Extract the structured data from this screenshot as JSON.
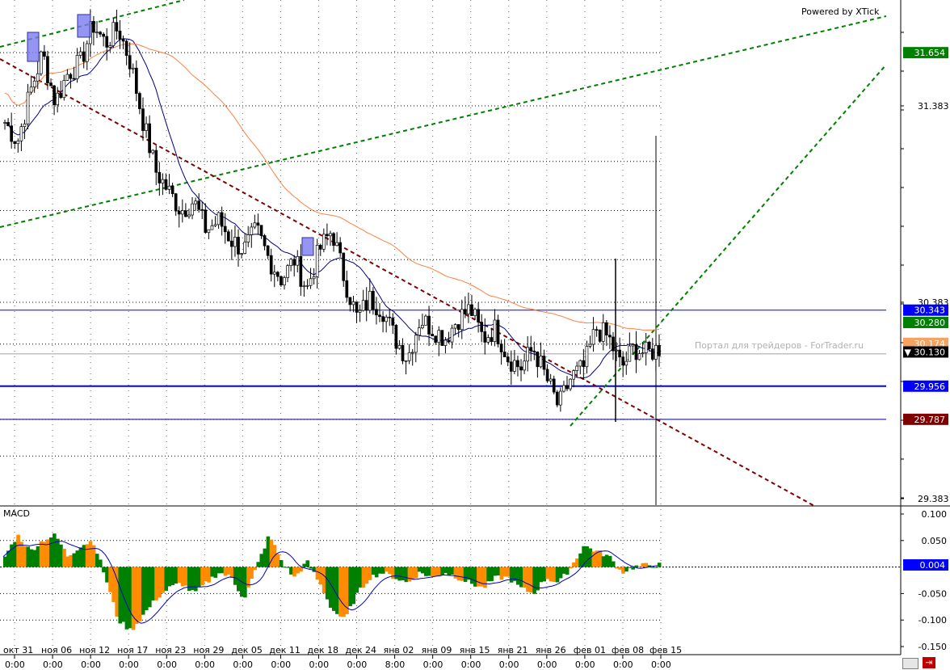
{
  "powered_by": "Powered by XTick",
  "watermark": "Портал для трейдеров - ForTrader.ru",
  "price_axis": {
    "ticks": [
      "31.383",
      "30.383",
      "29.383"
    ],
    "tick_values": [
      31.383,
      30.383,
      29.383
    ]
  },
  "price_labels": [
    {
      "text": "31.654",
      "value": 31.654,
      "bg": "#008000",
      "fg": "#ffffff"
    },
    {
      "text": "30.343",
      "value": 30.343,
      "bg": "#0000ff",
      "fg": "#ffffff"
    },
    {
      "text": "30.280",
      "value": 30.28,
      "bg": "#008000",
      "fg": "#ffffff"
    },
    {
      "text": "30.174",
      "value": 30.174,
      "bg": "#f4a460",
      "fg": "#ffffff"
    },
    {
      "text": "▼ 30.130",
      "value": 30.13,
      "bg": "#000000",
      "fg": "#ffffff"
    },
    {
      "text": "29.956",
      "value": 29.956,
      "bg": "#0000ff",
      "fg": "#ffffff"
    },
    {
      "text": "29.787",
      "value": 29.787,
      "bg": "#800000",
      "fg": "#ffffff"
    }
  ],
  "macd_panel": {
    "label": "MACD",
    "ticks": [
      "0.100",
      "0.050",
      "-0.050",
      "-0.100",
      "-0.150"
    ],
    "tick_values": [
      0.1,
      0.05,
      -0.05,
      -0.1,
      -0.15
    ],
    "current_label": {
      "text": "0.004",
      "value": 0.004,
      "bg": "#0000ff",
      "fg": "#ffffff"
    }
  },
  "time_axis": {
    "dates": [
      "окт 31",
      "ноя 06",
      "ноя 12",
      "ноя 17",
      "ноя 23",
      "ноя 29",
      "дек 05",
      "дек 11",
      "дек 18",
      "дек 24",
      "янв 02",
      "янв 09",
      "янв 15",
      "янв 21",
      "янв 26",
      "фев 01",
      "фев 08",
      "фев 15"
    ],
    "times": [
      "0:00",
      "0:00",
      "0:00",
      "0:00",
      "0:00",
      "0:00",
      "0:00",
      "0:00",
      "0:00",
      "0:00",
      "8:00",
      "0:00",
      "0:00",
      "0:00",
      "0:00",
      "0:00",
      "0:00",
      "0:00"
    ]
  },
  "colors": {
    "up_candle": "#000000",
    "down_candle": "#000000",
    "ma_fast": "#000080",
    "ma_slow": "#ff7f3f",
    "trend_green": "#008000",
    "trend_red": "#800000",
    "hist_up": "#008000",
    "hist_down": "#ff8c00",
    "level_blue": "#0000ff"
  },
  "chart_data": {
    "type": "candlestick",
    "instrument": "",
    "ylim": [
      29.383,
      31.9
    ],
    "x_categories": [
      "окт 31",
      "ноя 06",
      "ноя 12",
      "ноя 17",
      "ноя 23",
      "ноя 29",
      "дек 05",
      "дек 11",
      "дек 18",
      "дек 24",
      "янв 02",
      "янв 09",
      "янв 15",
      "янв 21",
      "янв 26",
      "фев 01",
      "фев 08",
      "фев 15"
    ],
    "close_path": [
      31.3,
      31.2,
      31.45,
      31.65,
      31.4,
      31.55,
      31.6,
      31.8,
      31.7,
      31.78,
      31.6,
      31.3,
      31.05,
      30.95,
      30.85,
      30.9,
      30.75,
      30.8,
      30.7,
      30.65,
      30.75,
      30.6,
      30.5,
      30.6,
      30.45,
      30.65,
      30.75,
      30.5,
      30.3,
      30.4,
      30.35,
      30.2,
      30.1,
      30.3,
      30.25,
      30.2,
      30.3,
      30.35,
      30.2,
      30.25,
      30.1,
      30.05,
      30.15,
      30.0,
      29.85,
      30.0,
      30.05,
      30.25,
      30.2,
      30.05,
      30.15,
      30.12,
      30.15
    ],
    "levels": [
      30.343,
      30.28,
      29.956,
      29.787
    ],
    "macd_histogram": [
      0.02,
      0.06,
      0.03,
      0.05,
      0.06,
      0.02,
      0.04,
      0.05,
      -0.02,
      -0.1,
      -0.12,
      -0.09,
      -0.06,
      -0.04,
      -0.03,
      -0.05,
      -0.03,
      -0.01,
      -0.02,
      -0.06,
      0.0,
      0.06,
      0.01,
      -0.02,
      0.01,
      -0.03,
      -0.08,
      -0.1,
      -0.05,
      -0.02,
      -0.01,
      -0.02,
      -0.03,
      -0.01,
      -0.02,
      -0.01,
      -0.02,
      -0.03,
      -0.04,
      -0.02,
      -0.02,
      -0.04,
      -0.05,
      -0.02,
      -0.03,
      0.0,
      0.04,
      0.03,
      0.02,
      -0.01,
      0.0,
      0.004,
      0.004
    ]
  }
}
